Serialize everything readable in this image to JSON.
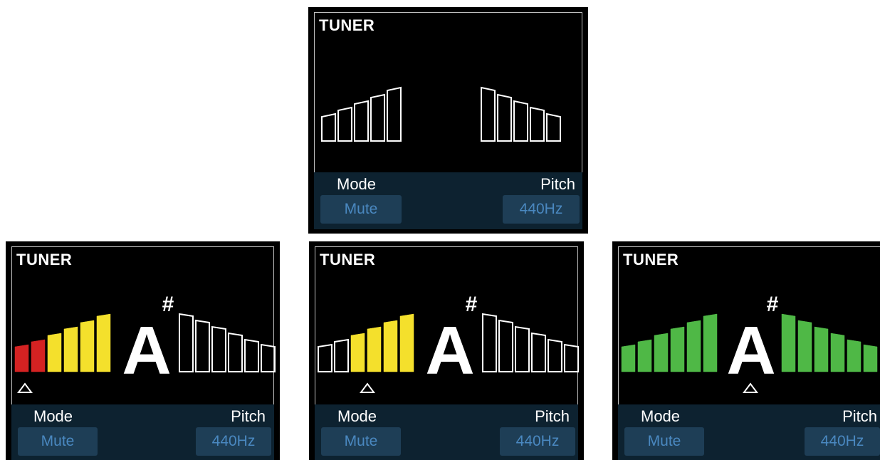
{
  "screens": [
    {
      "id": "idle",
      "title": "TUNER",
      "note": "",
      "sharp": "",
      "indicator": null,
      "left_bars": [
        "empty",
        "empty",
        "empty",
        "empty",
        "empty"
      ],
      "right_bars": [
        "empty",
        "empty",
        "empty",
        "empty",
        "empty"
      ],
      "mode_label": "Mode",
      "mode_value": "Mute",
      "pitch_label": "Pitch",
      "pitch_value": "440Hz"
    },
    {
      "id": "flat",
      "title": "TUNER",
      "note": "A",
      "sharp": "#",
      "indicator": "far-left",
      "left_bars": [
        "red",
        "red",
        "yellow",
        "yellow",
        "yellow",
        "yellow"
      ],
      "right_bars": [
        "empty",
        "empty",
        "empty",
        "empty",
        "empty",
        "empty"
      ],
      "mode_label": "Mode",
      "mode_value": "Mute",
      "pitch_label": "Pitch",
      "pitch_value": "440Hz"
    },
    {
      "id": "slightly-flat",
      "title": "TUNER",
      "note": "A",
      "sharp": "#",
      "indicator": "left",
      "left_bars": [
        "empty",
        "empty",
        "yellow",
        "yellow",
        "yellow",
        "yellow"
      ],
      "right_bars": [
        "empty",
        "empty",
        "empty",
        "empty",
        "empty",
        "empty"
      ],
      "mode_label": "Mode",
      "mode_value": "Mute",
      "pitch_label": "Pitch",
      "pitch_value": "440Hz"
    },
    {
      "id": "in-tune",
      "title": "TUNER",
      "note": "A",
      "sharp": "#",
      "indicator": "center",
      "left_bars": [
        "green",
        "green",
        "green",
        "green",
        "green",
        "green"
      ],
      "right_bars": [
        "green",
        "green",
        "green",
        "green",
        "green",
        "green"
      ],
      "mode_label": "Mode",
      "mode_value": "Mute",
      "pitch_label": "Pitch",
      "pitch_value": "440Hz"
    }
  ],
  "colors": {
    "red": "#d42222",
    "yellow": "#f4e02c",
    "green": "#4fb846",
    "outline": "#ffffff",
    "panel": "#0d2230",
    "value_box": "#1e3e56",
    "value_text": "#4a88c0"
  }
}
